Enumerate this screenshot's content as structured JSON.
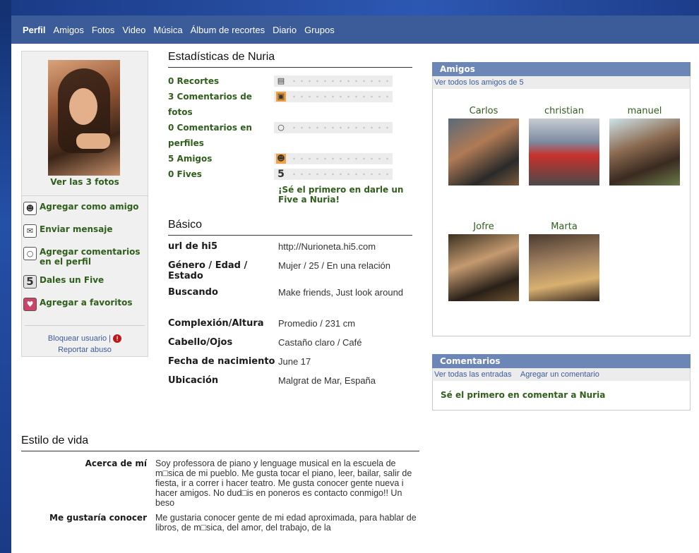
{
  "nav": {
    "items": [
      "Perfil",
      "Amigos",
      "Fotos",
      "Video",
      "Música",
      "Álbum de recortes",
      "Diario",
      "Grupos"
    ],
    "active": "Perfil"
  },
  "left": {
    "view_photos": "Ver las 3 fotos",
    "actions": [
      {
        "label": "Agregar como amigo",
        "icon": "add-friend-icon"
      },
      {
        "label": "Enviar mensaje",
        "icon": "envelope-icon"
      },
      {
        "label": "Agregar comentarios en el perfil",
        "icon": "speech-bubble-icon"
      },
      {
        "label": "Dales un Five",
        "icon": "five-icon"
      },
      {
        "label": "Agregar a favoritos",
        "icon": "heart-icon"
      }
    ],
    "block_user": "Bloquear usuario",
    "report_abuse": "Reportar abuso"
  },
  "stats": {
    "title": "Estadísticas de Nuria",
    "items": [
      {
        "label": "0 Recortes",
        "icon": "scrapbook-icon"
      },
      {
        "label": "3 Comentarios de fotos",
        "icon": "camera-icon"
      },
      {
        "label": "0 Comentarios en perfiles",
        "icon": "speech-bubble-icon"
      },
      {
        "label": "5 Amigos",
        "icon": "friend-icon"
      },
      {
        "label": "0 Fives",
        "icon": "five-icon"
      }
    ],
    "five_message": "¡Sé el primero en darle un Five a Nuria!"
  },
  "basic": {
    "title": "Básico",
    "rows": [
      {
        "k": "url de hi5",
        "v": "http://Nurioneta.hi5.com"
      },
      {
        "k": "Género / Edad / Estado",
        "v": "Mujer / 25 / En una relación"
      },
      {
        "k": "Buscando",
        "v": "Make friends, Just look around"
      },
      {
        "k": "Complexión/Altura",
        "v": "Promedio / 231 cm"
      },
      {
        "k": "Cabello/Ojos",
        "v": "Castaño claro / Café"
      },
      {
        "k": "Fecha de nacimiento",
        "v": "June 17"
      },
      {
        "k": "Ubicación",
        "v": "Malgrat de Mar, España"
      }
    ]
  },
  "friends": {
    "title": "Amigos",
    "view_all": "Ver todos los amigos de 5",
    "list": [
      {
        "name": "Carlos"
      },
      {
        "name": "christian"
      },
      {
        "name": "manuel"
      },
      {
        "name": "Jofre"
      },
      {
        "name": "Marta"
      }
    ]
  },
  "comments": {
    "title": "Comentarios",
    "view_all": "Ver todas las entradas",
    "add": "Agregar un comentario",
    "empty": "Sé el primero en comentar a Nuria"
  },
  "lifestyle": {
    "title": "Estilo de vida",
    "rows": [
      {
        "k": "Acerca de mí",
        "v": "Soy professora de piano y lenguage musical en la escuela de m□sica de mi pueblo. Me gusta tocar el piano, leer, bailar, salir de fiesta, ir a correr i hacer teatro. Me gusta conocer gente nueva i hacer amigos. No dud□is en poneros es contacto conmigo!! Un beso"
      },
      {
        "k": "Me gustaría conocer",
        "v": "Me gustaria conocer gente de mi edad aproximada, para hablar de libros, de m□sica, del amor, del trabajo, de la"
      }
    ]
  },
  "colors": {
    "nav_bg": "#3b5b99",
    "box_header": "#6c87b5",
    "green_text": "#2f5f1b",
    "link": "#3b5b99"
  }
}
